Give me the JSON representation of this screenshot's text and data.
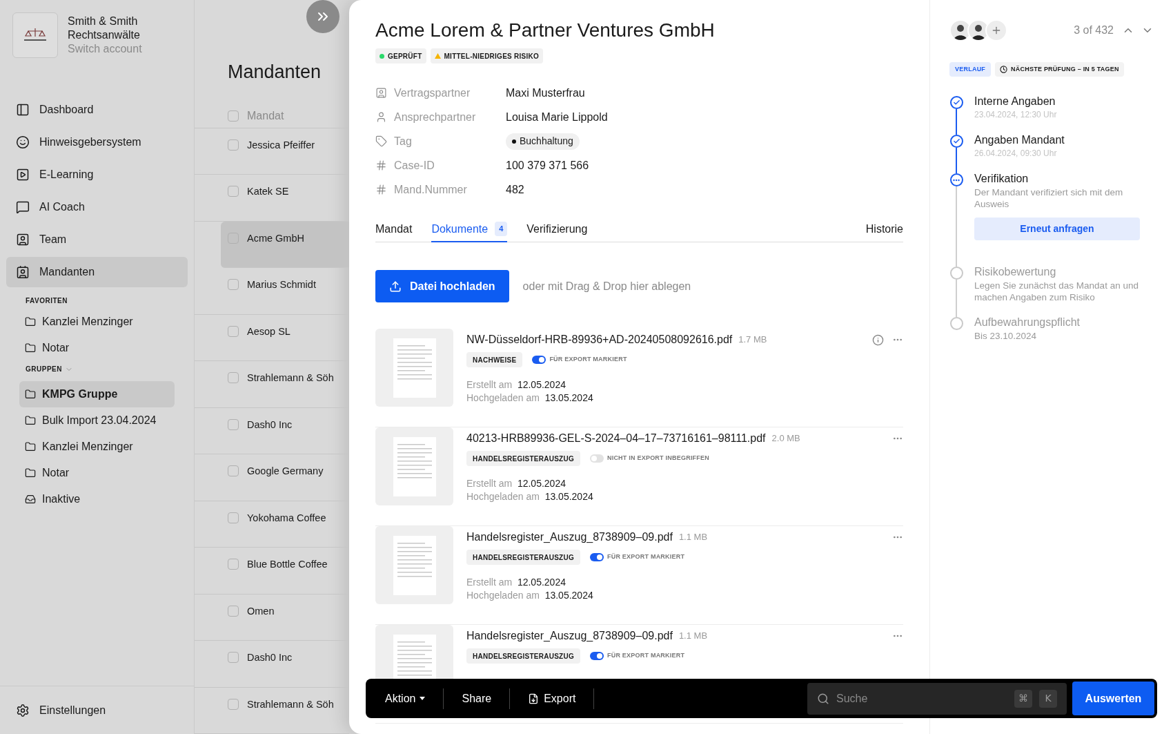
{
  "account": {
    "name": "Smith & Smith",
    "name_2": "Rechtsanwälte",
    "switch": "Switch account"
  },
  "nav": [
    {
      "label": "Dashboard",
      "selected": false
    },
    {
      "label": "Hinweisgebersystem",
      "selected": false
    },
    {
      "label": "E-Learning",
      "selected": false
    },
    {
      "label": "AI Coach",
      "selected": false
    },
    {
      "label": "Team",
      "selected": false
    },
    {
      "label": "Mandanten",
      "selected": true
    }
  ],
  "favorites": {
    "heading": "FAVORITEN",
    "items": [
      {
        "label": "Kanzlei Menzinger"
      },
      {
        "label": "Notar"
      }
    ]
  },
  "groups": {
    "heading": "GRUPPEN",
    "items": [
      {
        "label": "KMPG Gruppe",
        "kind": "folder",
        "selected": true
      },
      {
        "label": "Bulk Import 23.04.2024",
        "kind": "folder",
        "selected": false
      },
      {
        "label": "Kanzlei Menzinger",
        "kind": "folder",
        "selected": false
      },
      {
        "label": "Notar",
        "kind": "folder",
        "selected": false
      },
      {
        "label": "Inaktive",
        "kind": "inbox",
        "selected": false
      }
    ]
  },
  "settings": "Einstellungen",
  "list": {
    "title": "Mandanten",
    "header": "Mandat",
    "header_checked": false,
    "rows": [
      {
        "name": "Jessica Pfeiffer",
        "selected": false,
        "checked": false
      },
      {
        "name": "Katek SE",
        "selected": false,
        "checked": false
      },
      {
        "name": "Acme GmbH",
        "selected": true,
        "checked": false
      },
      {
        "name": "Marius Schmidt",
        "selected": false,
        "checked": false
      },
      {
        "name": "Aesop SL",
        "selected": false,
        "checked": false
      },
      {
        "name": "Strahlemann & Söh",
        "selected": false,
        "checked": false
      },
      {
        "name": "Dash0 Inc",
        "selected": false,
        "checked": false
      },
      {
        "name": "Google Germany",
        "selected": false,
        "checked": false
      },
      {
        "name": "Yokohama Coffee",
        "selected": false,
        "checked": false
      },
      {
        "name": "Blue Bottle Coffee",
        "selected": false,
        "checked": false
      },
      {
        "name": "Omen",
        "selected": false,
        "checked": false
      },
      {
        "name": "Dash0 Inc",
        "selected": false,
        "checked": false
      },
      {
        "name": "Strahlemann & Söh",
        "selected": false,
        "checked": false
      }
    ]
  },
  "detail": {
    "title": "Acme Lorem & Partner Ventures GmbH",
    "badges": [
      {
        "label": "GEPRÜFT",
        "kind": "status"
      },
      {
        "label": "MITTEL-NIEDRIGES RISIKO",
        "kind": "risk"
      }
    ],
    "fields": [
      {
        "label": "Vertragspartner",
        "value": "Maxi Musterfrau",
        "kind": "text"
      },
      {
        "label": "Ansprechpartner",
        "value": "Louisa Marie Lippold",
        "kind": "text"
      },
      {
        "label": "Tag",
        "value": "Buchhaltung",
        "kind": "tag"
      },
      {
        "label": "Case-ID",
        "value": "100 379 371 566",
        "kind": "text"
      },
      {
        "label": "Mand.Nummer",
        "value": "482",
        "kind": "text"
      }
    ],
    "tabs": [
      {
        "label": "Mandat",
        "selected": false
      },
      {
        "label": "Dokumente",
        "count": "4",
        "selected": true
      },
      {
        "label": "Verifizierung",
        "selected": false
      },
      {
        "label": "Historie",
        "selected": false
      }
    ],
    "upload": {
      "button": "Datei hochladen",
      "hint": "oder mit Drag & Drop hier ablegen"
    },
    "documents": [
      {
        "name": "NW-Düsseldorf-HRB-89936+AD-20240508092616.pdf",
        "size": "1.7 MB",
        "tag": "NACHWEISE",
        "export_on": true,
        "export_label": "FÜR EXPORT MARKIERT",
        "info": true,
        "created_label": "Erstellt am",
        "created": "12.05.2024",
        "uploaded_label": "Hochgeladen am",
        "uploaded": "13.05.2024"
      },
      {
        "name": "40213-HRB89936-GEL-S-2024–04–17–73716161–98111.pdf",
        "size": "2.0 MB",
        "tag": "HANDELSREGISTERAUSZUG",
        "export_on": false,
        "export_label": "NICHT IN EXPORT INBEGRIFFEN",
        "info": false,
        "created_label": "Erstellt am",
        "created": "12.05.2024",
        "uploaded_label": "Hochgeladen am",
        "uploaded": "13.05.2024"
      },
      {
        "name": "Handelsregister_Auszug_8738909–09.pdf",
        "size": "1.1 MB",
        "tag": "HANDELSREGISTERAUSZUG",
        "export_on": true,
        "export_label": "FÜR EXPORT MARKIERT",
        "info": false,
        "created_label": "Erstellt am",
        "created": "12.05.2024",
        "uploaded_label": "Hochgeladen am",
        "uploaded": "13.05.2024"
      },
      {
        "name": "Handelsregister_Auszug_8738909–09.pdf",
        "size": "1.1 MB",
        "tag": "HANDELSREGISTERAUSZUG",
        "export_on": true,
        "export_label": "FÜR EXPORT MARKIERT",
        "info": false
      }
    ]
  },
  "side": {
    "counter": "3 of 432",
    "history_badge": "VERLAUF",
    "next_check": "NÄCHSTE PRÜFUNG – IN 5 TAGEN",
    "steps": [
      {
        "title": "Interne Angaben",
        "subtitle": "23.04.2024, 12:30 Uhr",
        "completed": true,
        "current": false
      },
      {
        "title": "Angaben Mandant",
        "subtitle": "26.04.2024, 09:30 Uhr",
        "completed": true,
        "current": false
      },
      {
        "title": "Verifikation",
        "subtitle": "Der Mandant verifiziert sich mit dem Ausweis",
        "completed": false,
        "current": true,
        "action": "Erneut anfragen"
      },
      {
        "title": "Risikobewertung",
        "subtitle": "Legen Sie zunächst das Mandat an und machen Angaben zum Risiko",
        "completed": false,
        "current": false
      },
      {
        "title": "Aufbewahrungspflicht",
        "subtitle": "Bis 23.10.2024",
        "completed": false,
        "current": false
      }
    ]
  },
  "actionbar": {
    "action": "Aktion",
    "share": "Share",
    "export": "Export",
    "search_placeholder": "Suche",
    "keys": [
      "⌘",
      "K"
    ],
    "submit": "Auswerten"
  }
}
